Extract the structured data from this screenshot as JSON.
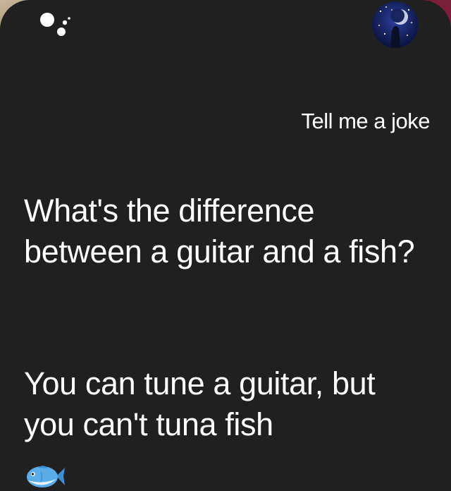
{
  "assistant": {
    "logo_icon": "google-assistant-icon",
    "avatar_icon": "user-avatar-icon"
  },
  "conversation": {
    "user_query": "Tell me a joke",
    "response_question": "What's the difference between a guitar and a fish?",
    "response_punchline": "You can tune a guitar, but you can't tuna fish",
    "emoji_icon": "fish-emoji-icon"
  },
  "colors": {
    "background": "#202020",
    "text": "#ffffff"
  }
}
